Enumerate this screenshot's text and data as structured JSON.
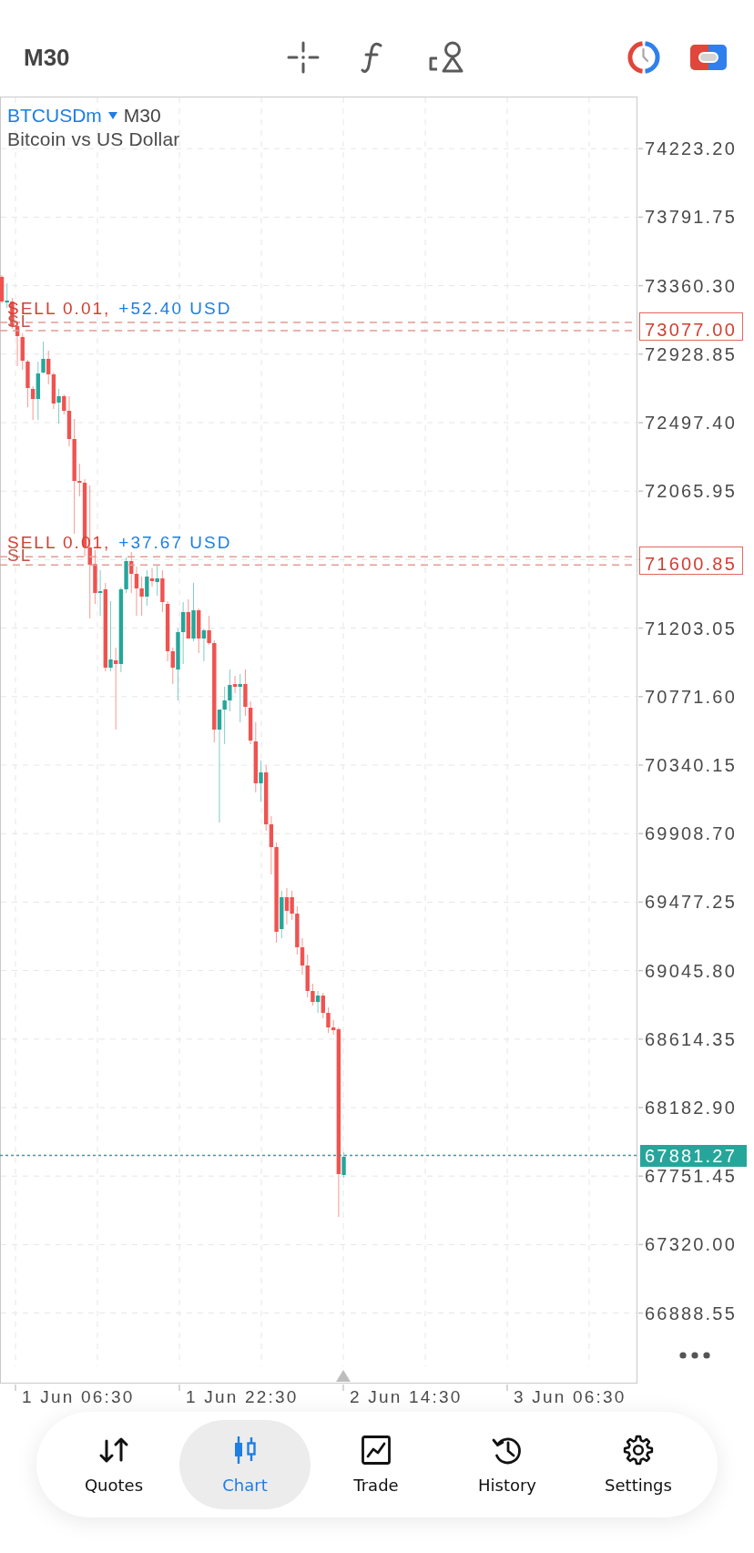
{
  "toolbar": {
    "timeframe": "M30"
  },
  "chart": {
    "symbol": "BTCUSDm",
    "timeframe": "M30",
    "description": "Bitcoin vs US Dollar",
    "price_scale": [
      "74223.20",
      "73791.75",
      "73360.30",
      "72928.85",
      "72497.40",
      "72065.95",
      "71203.05",
      "70771.60",
      "70340.15",
      "69908.70",
      "69477.25",
      "69045.80",
      "68614.35",
      "68182.90",
      "67751.45",
      "67320.00",
      "66888.55"
    ],
    "orders": [
      {
        "label": "SELL 0.01,",
        "profit": "+52.40 USD",
        "stop_loss": {
          "label": "SL",
          "price": "73077.00"
        }
      },
      {
        "label": "SELL 0.01,",
        "profit": "+37.67 USD",
        "stop_loss": {
          "label": "SL",
          "price": "71600.85"
        }
      }
    ],
    "current_price": "67881.27",
    "time_scale": [
      "1 Jun 06:30",
      "1 Jun 22:30",
      "2 Jun 14:30",
      "3 Jun 06:30"
    ]
  },
  "navigation": [
    {
      "label": "Quotes",
      "selected": false
    },
    {
      "label": "Chart",
      "selected": true
    },
    {
      "label": "Trade",
      "selected": false
    },
    {
      "label": "History",
      "selected": false
    },
    {
      "label": "Settings",
      "selected": false
    }
  ]
}
